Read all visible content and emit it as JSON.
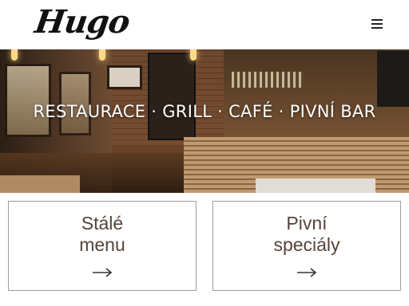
{
  "header": {
    "logo_text": "Hugo",
    "menu_icon": "hamburger-menu-icon"
  },
  "hero": {
    "title": "RESTAURACE · GRILL · CAFÉ · PIVNÍ BAR"
  },
  "cards": [
    {
      "label": "Stálé\nmenu",
      "icon": "arrow-right-icon"
    },
    {
      "label": "Pivní\nspeciály",
      "icon": "arrow-right-icon"
    }
  ],
  "colors": {
    "card_text": "#55443a",
    "card_border": "#9e9e9e",
    "logo": "#111111"
  }
}
